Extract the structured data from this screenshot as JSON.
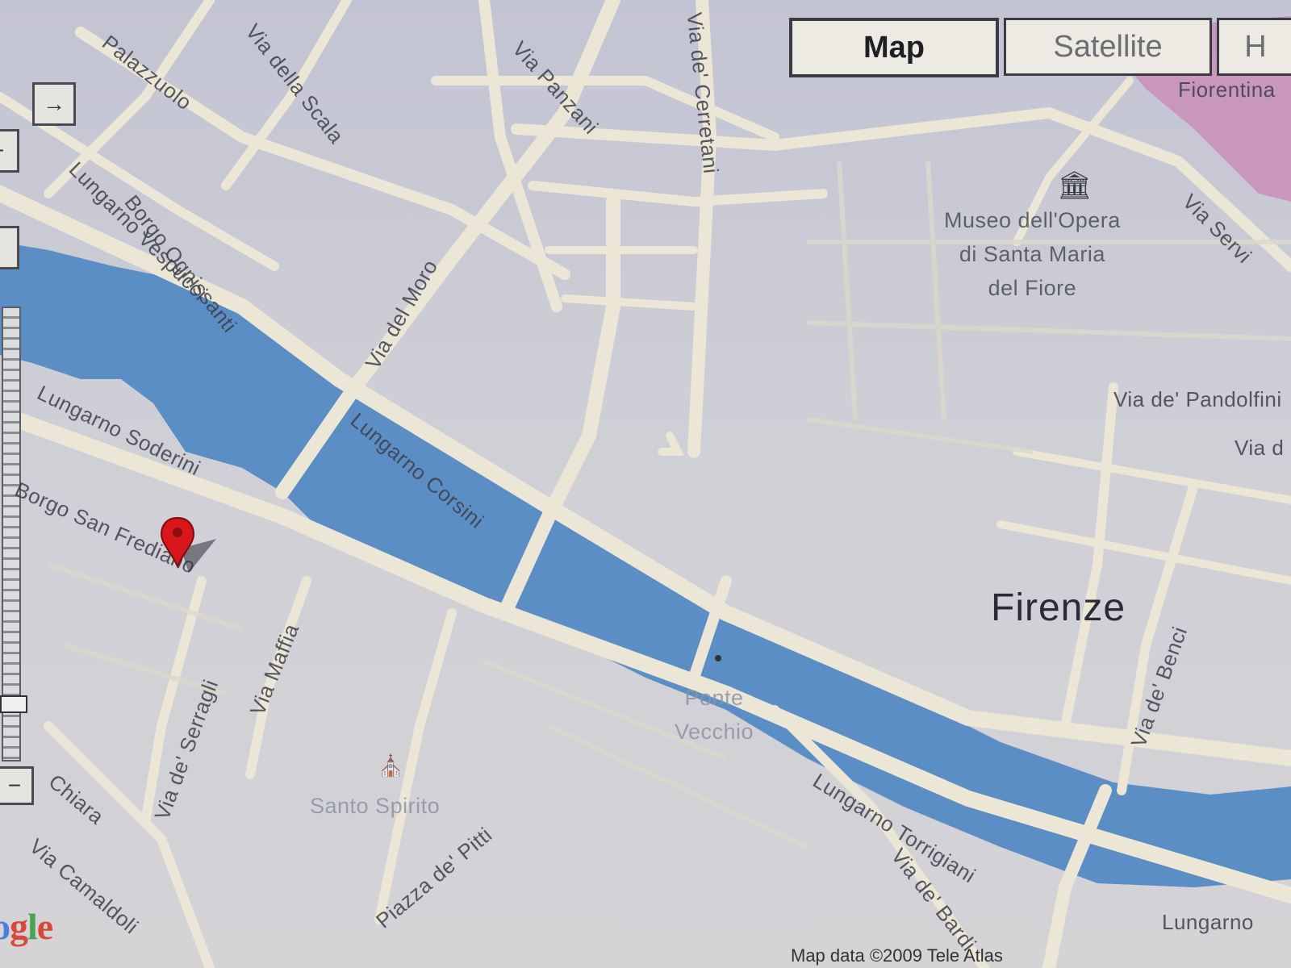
{
  "map_type_control": {
    "map_label": "Map",
    "satellite_label": "Satellite",
    "hybrid_label": "H",
    "active": "Map"
  },
  "controls": {
    "pan_right_icon": "arrow-right-icon",
    "zoom_slider": "zoom-slider"
  },
  "city_label": "Firenze",
  "street_labels": {
    "via_panzani": "Via Panzani",
    "via_dei_cerretani": "Via de' Cerretani",
    "via_della_scala": "Via della Scala",
    "via_palazzuolo": "Palazzuolo",
    "borgo_ognissanti": "Borgo Ognissanti",
    "via_del_moro": "Via del Moro",
    "lungarno_vespucci": "Lungarno Vespucci",
    "lungarno_soderini": "Lungarno Soderini",
    "lungarno_corsini": "Lungarno Corsini",
    "borgo_san_frediano": "Borgo San Frediano",
    "via_maffia": "Via Maffia",
    "via_dei_serragli": "Via de' Serragli",
    "via_chiara": "Chiara",
    "via_camaldoli": "Via Camaldoli",
    "piazza_de_pitti": "Piazza de' Pitti",
    "lungarno_torrigiani": "Lungarno Torrigiani",
    "via_de_bardi": "Via de' Bardi",
    "via_de_benci": "Via de' Benci",
    "via_dei_pandolfini": "Via de' Pandolfini",
    "via_right_cut": "Via d",
    "via_servi": "Via Servi",
    "fiorentina_cut": "Fiorentina",
    "lungarno_bottom_right": "Lungarno"
  },
  "poi": {
    "museo": "Museo dell'Opera\ndi Santa Maria\ndel Fiore",
    "museo_icon": "museum-icon",
    "ponte_vecchio": "Ponte\nVecchio",
    "santo_spirito": "Santo Spirito",
    "church_icon": "church-icon"
  },
  "marker": {
    "icon": "map-marker-icon",
    "color": "#d8161c"
  },
  "logo": {
    "text_visible": "ogle",
    "colors": [
      "#3a6fd8",
      "#d8331e",
      "#e9b02b",
      "#2f9c3b"
    ]
  },
  "copyright": "Map data ©2009 Tele Atlas",
  "colors": {
    "river": "#5b8ec4",
    "road": "#ebe6d6",
    "land": "#cfcfd6",
    "park_pink": "#c78cbc"
  }
}
